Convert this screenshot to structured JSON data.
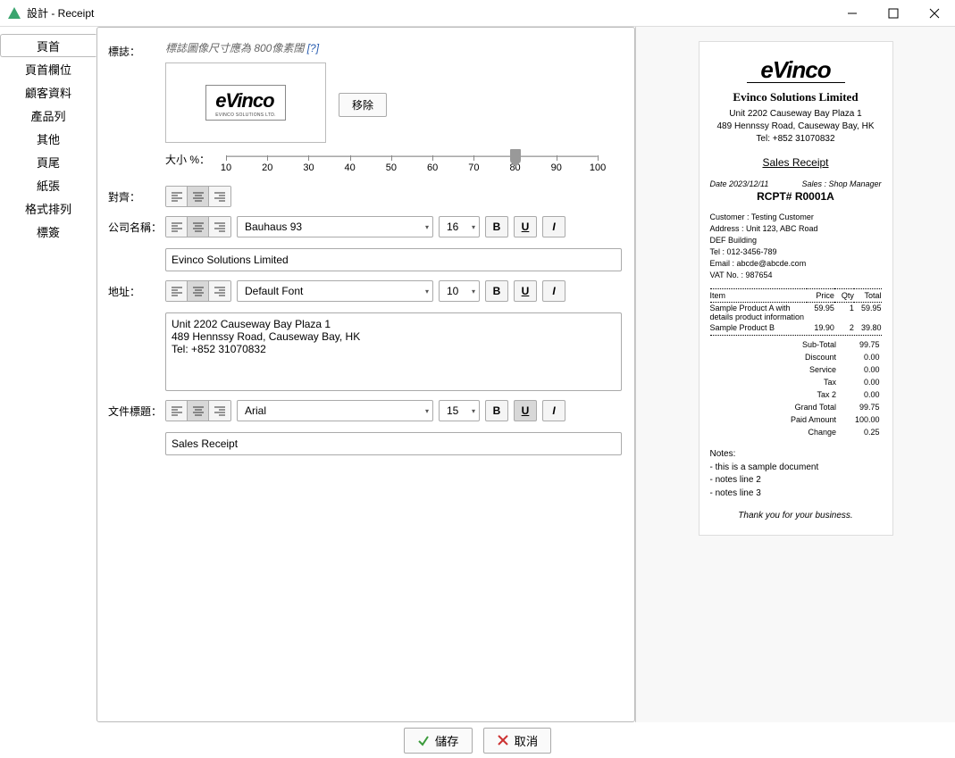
{
  "window": {
    "title": "設計 - Receipt"
  },
  "tabs": {
    "items": [
      "頁首",
      "頁首欄位",
      "顧客資料",
      "產品列",
      "其他",
      "頁尾",
      "紙張",
      "格式排列",
      "標簽"
    ],
    "selected": 0
  },
  "labels": {
    "logo": "標誌：",
    "logoHint": "標誌圖像尺寸應為 800像素闊",
    "logoHintLink": "[?]",
    "remove": "移除",
    "sizePct": "大小 %：",
    "align": "對齊：",
    "company": "公司名稱：",
    "address": "地址：",
    "docTitle": "文件標題：",
    "save": "儲存",
    "cancel": "取消"
  },
  "slider": {
    "ticks": [
      10,
      20,
      30,
      40,
      50,
      60,
      70,
      80,
      90,
      100
    ],
    "value": 80
  },
  "logoAlign": {
    "active": 1
  },
  "company": {
    "align": 1,
    "font": "Bauhaus 93",
    "size": "16",
    "bold": false,
    "underline": false,
    "italic": false,
    "value": "Evinco Solutions Limited"
  },
  "address": {
    "align": 1,
    "font": "Default Font",
    "size": "10",
    "bold": false,
    "underline": false,
    "italic": false,
    "value": "Unit 2202 Causeway Bay Plaza 1\n489 Hennssy Road, Causeway Bay, HK\nTel: +852 31070832"
  },
  "docTitle": {
    "align": 1,
    "font": "Arial",
    "size": "15",
    "bold": false,
    "underline": true,
    "italic": false,
    "value": "Sales Receipt"
  },
  "preview": {
    "company": "Evinco Solutions Limited",
    "addr1": "Unit 2202 Causeway Bay Plaza 1",
    "addr2": "489 Hennssy Road, Causeway Bay, HK",
    "addr3": "Tel: +852 31070832",
    "title": "Sales Receipt",
    "date": "Date 2023/12/11",
    "sales": "Sales : Shop Manager",
    "receiptId": "RCPT# R0001A",
    "cust": [
      "Customer : Testing Customer",
      "Address : Unit 123, ABC Road",
      "DEF Building",
      "Tel : 012-3456-789",
      "Email : abcde@abcde.com",
      "VAT No. : 987654"
    ],
    "cols": [
      "Item",
      "Price",
      "Qty",
      "Total"
    ],
    "items": [
      {
        "name": "Sample Product A with details product information",
        "price": "59.95",
        "qty": "1",
        "total": "59.95"
      },
      {
        "name": "Sample Product B",
        "price": "19.90",
        "qty": "2",
        "total": "39.80"
      }
    ],
    "totals": [
      [
        "Sub-Total",
        "99.75"
      ],
      [
        "Discount",
        "0.00"
      ],
      [
        "Service",
        "0.00"
      ],
      [
        "Tax",
        "0.00"
      ],
      [
        "Tax 2",
        "0.00"
      ],
      [
        "Grand Total",
        "99.75"
      ],
      [
        "Paid Amount",
        "100.00"
      ],
      [
        "Change",
        "0.25"
      ]
    ],
    "notesTitle": "Notes:",
    "notes": [
      "- this is a sample document",
      "- notes line 2",
      "- notes line 3"
    ],
    "thanks": "Thank you for your business."
  }
}
